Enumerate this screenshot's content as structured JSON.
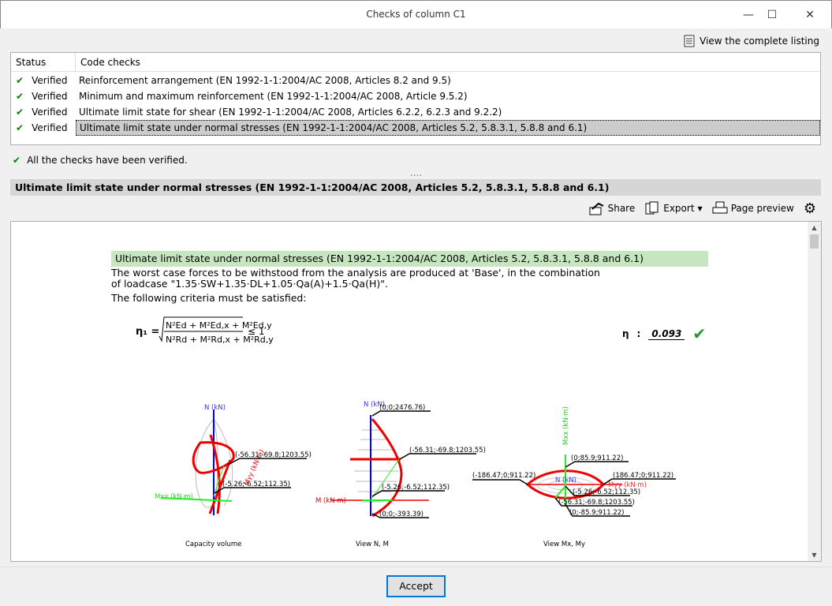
{
  "window": {
    "title": "Checks of column C1",
    "minimize": "—",
    "maximize": "☐",
    "close": "✕"
  },
  "listing_label": "View the complete listing",
  "table": {
    "headers": [
      "Status",
      "Code checks"
    ],
    "rows": [
      {
        "status": "Verified",
        "check": "Reinforcement arrangement (EN 1992-1-1:2004/AC 2008, Articles 8.2 and 9.5)"
      },
      {
        "status": "Verified",
        "check": "Minimum and maximum reinforcement (EN 1992-1-1:2004/AC 2008, Article 9.5.2)"
      },
      {
        "status": "Verified",
        "check": "Ultimate limit state for shear (EN 1992-1-1:2004/AC 2008, Articles 6.2.2, 6.2.3 and 9.2.2)"
      },
      {
        "status": "Verified",
        "check": "Ultimate limit state under normal stresses (EN 1992-1-1:2004/AC 2008, Articles 5.2, 5.8.3.1, 5.8.8 and 6.1)",
        "selected": true
      }
    ]
  },
  "summary": "All the checks have been verified.",
  "splitter": "....",
  "section_title": "Ultimate limit state under normal stresses (EN 1992-1-1:2004/AC 2008, Articles 5.2, 5.8.3.1, 5.8.8 and 6.1)",
  "toolbar": {
    "share": "Share",
    "export": "Export",
    "page_preview": "Page preview"
  },
  "report": {
    "heading": "Ultimate limit state under normal stresses (EN 1992-1-1:2004/AC 2008, Articles 5.2, 5.8.3.1, 5.8.8 and 6.1)",
    "line1": "The worst case forces to be withstood from the analysis are produced at 'Base', in the combination",
    "line2": "of loadcase \"1.35·SW+1.35·DL+1.05·Qa(A)+1.5·Qa(H)\".",
    "line3": "The following criteria must be satisfied:",
    "eta_label": "η",
    "eta_value": "0.093",
    "diagrams": {
      "capacity": {
        "caption": "Capacity volume",
        "n_axis": "N (kN)",
        "mx_axis": "Mxx (kN·m)",
        "my_axis": "Myy (kN·m)",
        "p1": "(-56.31;-69.8;1203.55)",
        "p2": "(-5.26;-6.52;112.35)"
      },
      "nm": {
        "caption": "View N, M",
        "n_axis": "N (kN)",
        "m_axis": "M (kN·m)",
        "p_top": "(0;0;2476.76)",
        "p1": "(-56.31;-69.8;1203.55)",
        "p2": "(-5.26;-6.52;112.35)",
        "p_bot": "(0;0;-393.39)"
      },
      "mxmy": {
        "caption": "View Mx, My",
        "n_axis": "N (kN)",
        "mx_axis": "Mxx (kN·m)",
        "my_axis": "Myy (kN·m)",
        "p_top": "(0;85.9;911.22)",
        "p_left": "(-186.47;0;911.22)",
        "p_right": "(186.47;0;911.22)",
        "p2": "(-5.26;-6.52;112.35)",
        "p1": "(-56.31;-69.8;1203.55)",
        "p_bot": "(0;-85.9;911.22)"
      }
    }
  },
  "accept": "Accept"
}
